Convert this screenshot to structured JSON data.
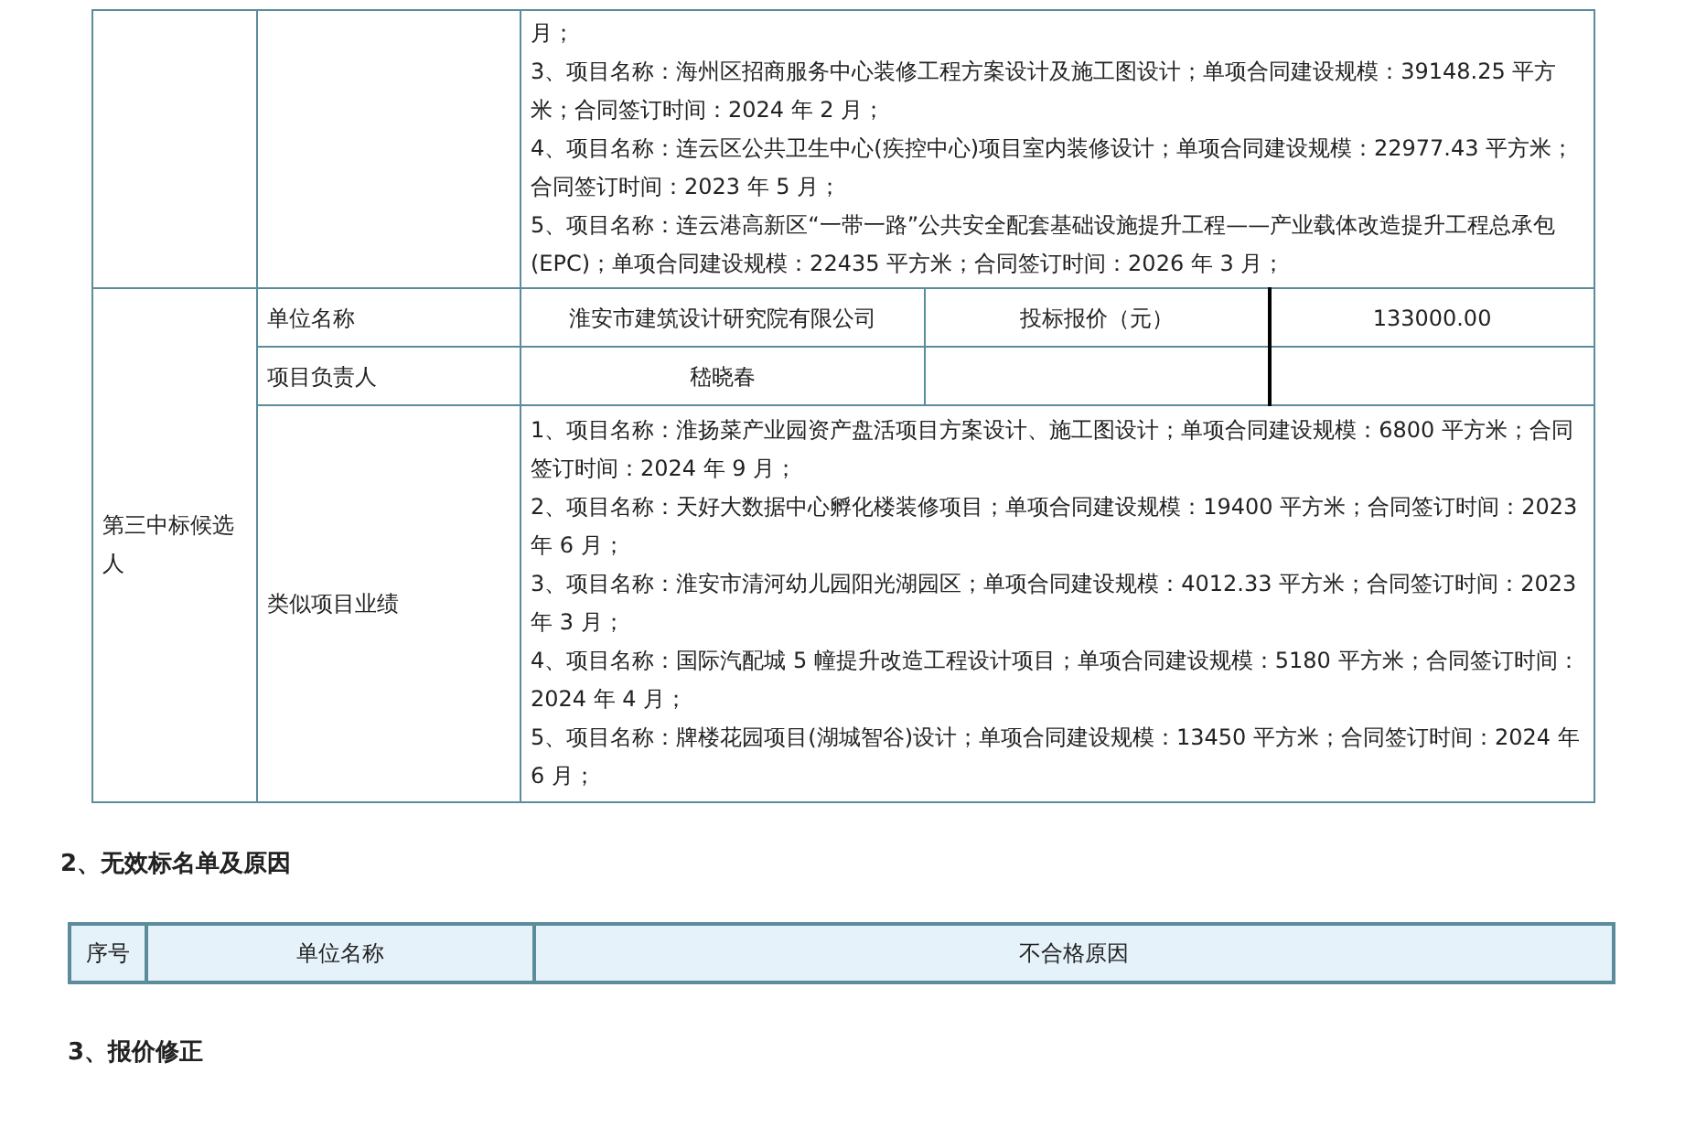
{
  "candidate_table": {
    "continued_performance": [
      "月；",
      "3、项目名称：海州区招商服务中心装修工程方案设计及施工图设计；单项合同建设规模：39148.25 平方米；合同签订时间：2024 年 2 月；",
      "4、项目名称：连云区公共卫生中心(疾控中心)项目室内装修设计；单项合同建设规模：22977.43 平方米；合同签订时间：2023 年 5 月；",
      "5、项目名称：连云港高新区“一带一路”公共安全配套基础设施提升工程——产业载体改造提升工程总承包(EPC)；单项合同建设规模：22435 平方米；合同签订时间：2026 年 3 月；"
    ],
    "third_candidate": {
      "label": "第三中标候选人",
      "unit_label": "单位名称",
      "unit_value": "淮安市建筑设计研究院有限公司",
      "price_label": "投标报价（元）",
      "price_value": "133000.00",
      "manager_label": "项目负责人",
      "manager_value": "嵇晓春",
      "performance_label": "类似项目业绩",
      "performance": [
        "1、项目名称：淮扬菜产业园资产盘活项目方案设计、施工图设计；单项合同建设规模：6800 平方米；合同签订时间：2024 年 9 月；",
        "2、项目名称：天好大数据中心孵化楼装修项目；单项合同建设规模：19400 平方米；合同签订时间：2023 年 6 月；",
        "3、项目名称：淮安市清河幼儿园阳光湖园区；单项合同建设规模：4012.33 平方米；合同签订时间：2023 年 3 月；",
        "4、项目名称：国际汽配城 5 幢提升改造工程设计项目；单项合同建设规模：5180 平方米；合同签订时间：2024 年 4 月；",
        "5、项目名称：牌楼花园项目(湖城智谷)设计；单项合同建设规模：13450 平方米；合同签订时间：2024 年 6 月；"
      ]
    }
  },
  "invalid_section": {
    "heading": "2、无效标名单及原因",
    "columns": [
      "序号",
      "单位名称",
      "不合格原因"
    ]
  },
  "next_section": {
    "heading": "3、报价修正"
  }
}
